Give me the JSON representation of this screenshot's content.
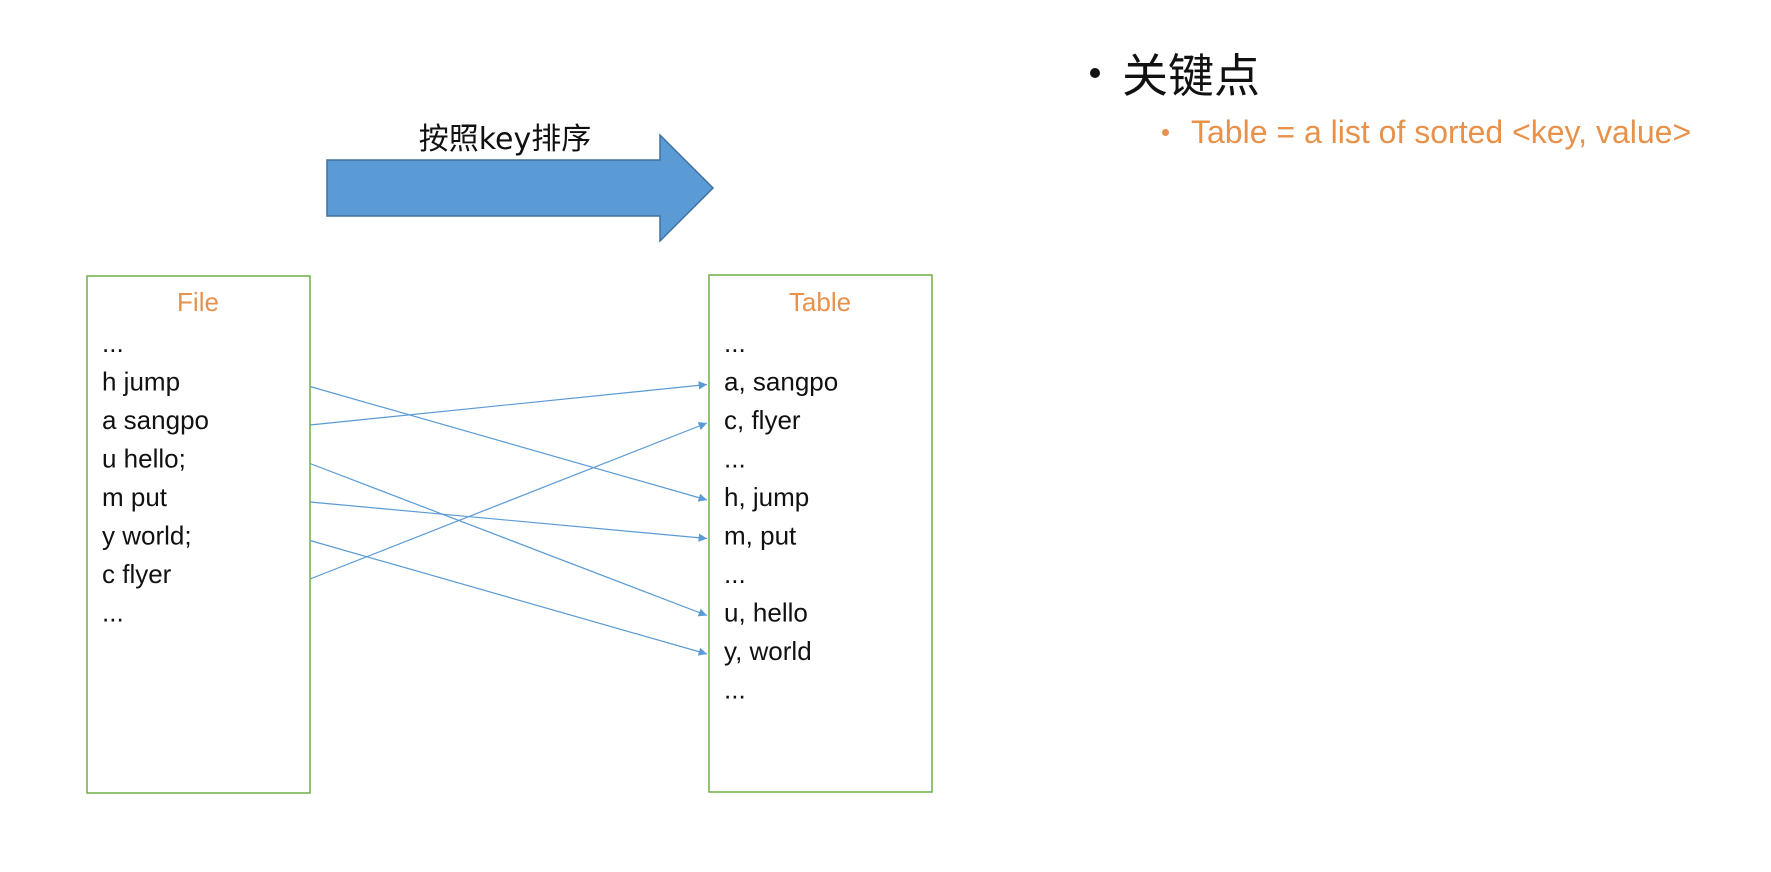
{
  "arrow_label": "按照key排序",
  "file_box": {
    "title": "File",
    "rows": [
      "...",
      "h jump",
      "a sangpo",
      "u hello;",
      "m put",
      "y world;",
      "c flyer",
      "..."
    ]
  },
  "table_box": {
    "title": "Table",
    "rows": [
      "...",
      "a, sangpo",
      "c, flyer",
      "...",
      "h, jump",
      "m, put",
      "...",
      "u, hello",
      "y, world",
      "..."
    ]
  },
  "mappings": [
    {
      "from": 1,
      "to": 4
    },
    {
      "from": 2,
      "to": 1
    },
    {
      "from": 3,
      "to": 7
    },
    {
      "from": 4,
      "to": 5
    },
    {
      "from": 5,
      "to": 8
    },
    {
      "from": 6,
      "to": 2
    }
  ],
  "bullets": {
    "main": "关键点",
    "sub": "Table = a list of sorted <key, value>"
  },
  "colors": {
    "box_border": "#70AD47",
    "title_text": "#E8914A",
    "big_arrow_fill": "#5B9BD5",
    "big_arrow_stroke": "#41719C",
    "connector": "#5B9BD5"
  }
}
